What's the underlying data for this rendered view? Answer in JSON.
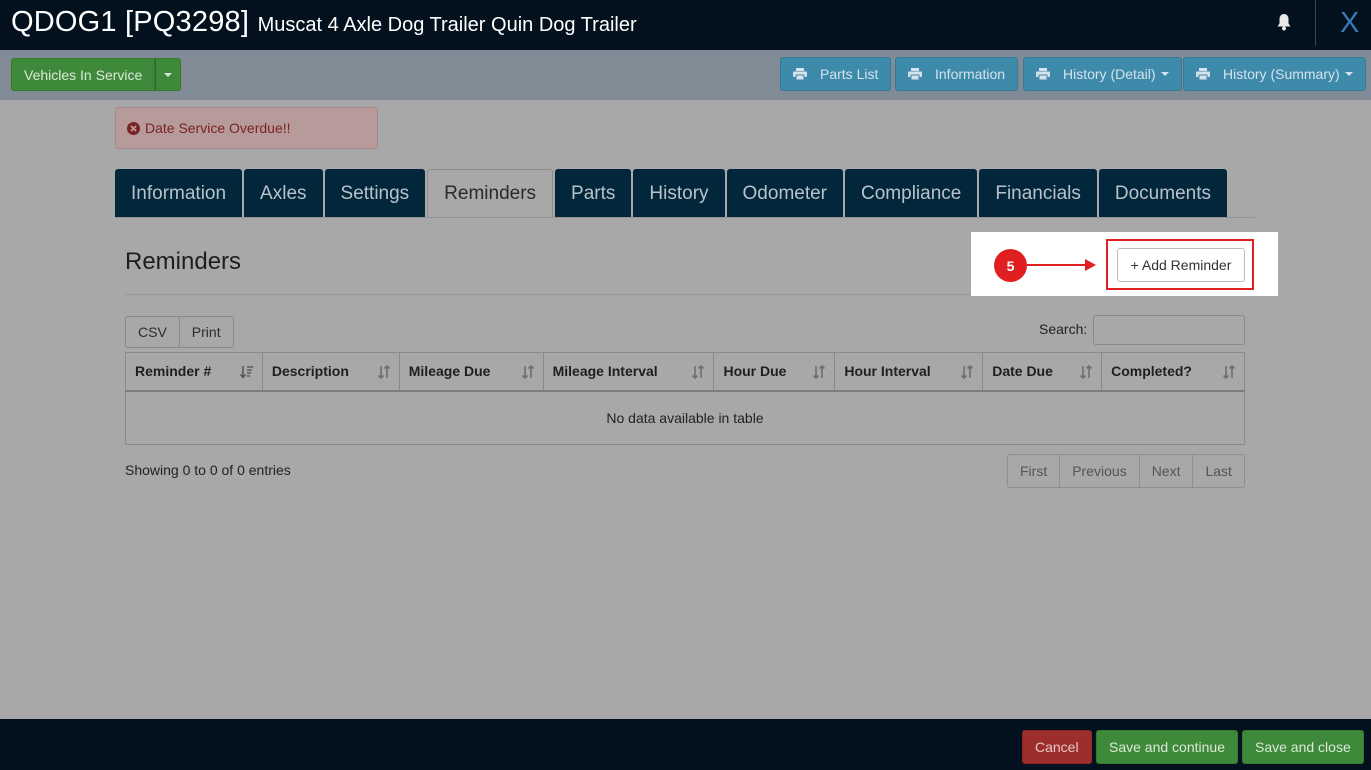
{
  "header": {
    "vehicle_code": "QDOG1 [PQ3298]",
    "vehicle_description": "Muscat 4 Axle Dog Trailer Quin Dog Trailer",
    "close_label": "X"
  },
  "toolbar": {
    "status_button": "Vehicles In Service",
    "print_buttons": [
      {
        "label": "Parts List"
      },
      {
        "label": "Information"
      },
      {
        "label": "History (Detail)"
      },
      {
        "label": "History (Summary)"
      }
    ]
  },
  "alert": {
    "text": "Date Service Overdue!!"
  },
  "tabs": [
    {
      "label": "Information"
    },
    {
      "label": "Axles"
    },
    {
      "label": "Settings"
    },
    {
      "label": "Reminders",
      "active": true
    },
    {
      "label": "Parts"
    },
    {
      "label": "History"
    },
    {
      "label": "Odometer"
    },
    {
      "label": "Compliance"
    },
    {
      "label": "Financials"
    },
    {
      "label": "Documents"
    }
  ],
  "section": {
    "title": "Reminders"
  },
  "annotation": {
    "step_number": "5"
  },
  "add_button": {
    "label": "+ Add Reminder"
  },
  "export_buttons": {
    "csv": "CSV",
    "print": "Print"
  },
  "search": {
    "label": "Search:",
    "value": ""
  },
  "table": {
    "columns": [
      "Reminder #",
      "Description",
      "Mileage Due",
      "Mileage Interval",
      "Hour Due",
      "Hour Interval",
      "Date Due",
      "Completed?"
    ],
    "empty_message": "No data available in table"
  },
  "info": {
    "showing": "Showing 0 to 0 of 0 entries"
  },
  "pagination": {
    "first": "First",
    "previous": "Previous",
    "next": "Next",
    "last": "Last"
  },
  "footer": {
    "cancel": "Cancel",
    "save_continue": "Save and continue",
    "save_close": "Save and close"
  },
  "colors": {
    "header_bg": "#02111d",
    "tab_bg": "#02263a",
    "primary_green": "#3e8a3a",
    "info_blue": "#3e8aab",
    "danger_red": "#9e2e2b",
    "annotation_red": "#e02020"
  }
}
